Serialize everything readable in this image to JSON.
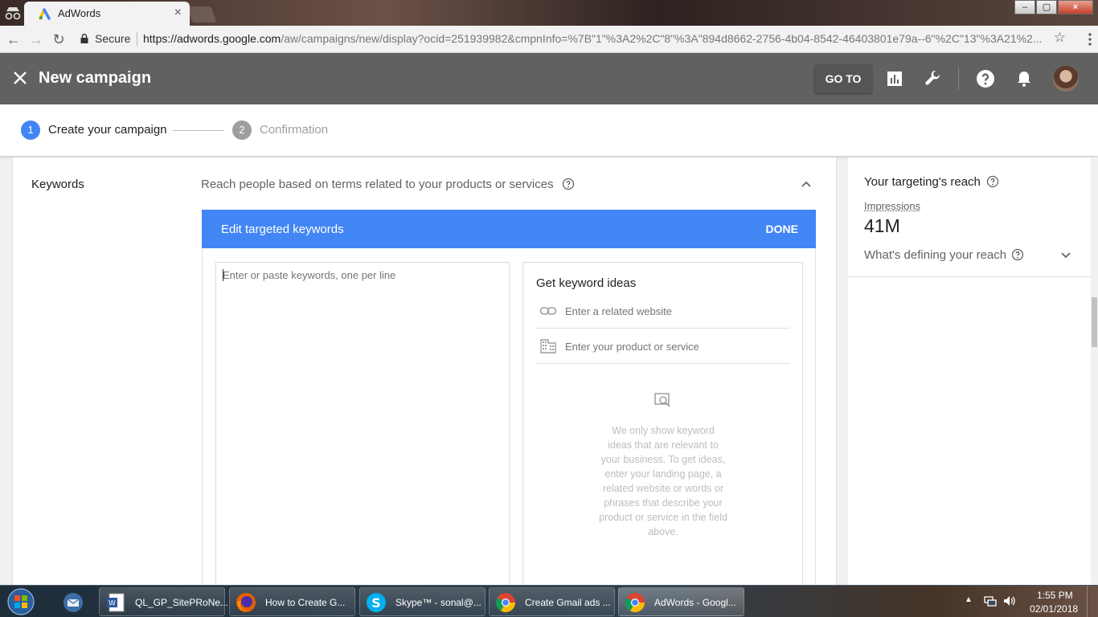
{
  "browser": {
    "tab_title": "AdWords",
    "tab_close": "×",
    "secure_label": "Secure",
    "url_host": "https://adwords.google.com",
    "url_path": "/aw/campaigns/new/display?ocid=251939982&cmpnInfo=%7B\"1\"%3A2%2C\"8\"%3A\"894d8662-2756-4b04-8542-46403801e79a--6\"%2C\"13\"%3A21%2..."
  },
  "header": {
    "title": "New campaign",
    "goto_label": "GO TO"
  },
  "stepper": {
    "step1_num": "1",
    "step1_label": "Create your campaign",
    "step2_num": "2",
    "step2_label": "Confirmation"
  },
  "keywords": {
    "label": "Keywords",
    "description": "Reach people based on terms related to your products or services",
    "edit_title": "Edit targeted keywords",
    "done_label": "DONE",
    "textarea_placeholder": "Enter or paste keywords, one per line"
  },
  "ideas": {
    "title": "Get keyword ideas",
    "website_placeholder": "Enter a related website",
    "product_placeholder": "Enter your product or service",
    "empty_text": "We only show keyword ideas that are relevant to your business. To get ideas, enter your landing page, a related website or words or phrases that describe your product or service in the field above."
  },
  "reach": {
    "title": "Your targeting's reach",
    "impressions_label": "Impressions",
    "impressions_value": "41M",
    "defining_label": "What's defining your reach"
  },
  "taskbar": {
    "items": [
      {
        "label": "QL_GP_SitePRoNe..."
      },
      {
        "label": "How to Create G..."
      },
      {
        "label": "Skype™ - sonal@..."
      },
      {
        "label": "Create Gmail ads ..."
      },
      {
        "label": "AdWords - Googl..."
      }
    ],
    "time": "1:55 PM",
    "date": "02/01/2018"
  },
  "colors": {
    "accent": "#4285f4",
    "header_bg": "#616161"
  }
}
